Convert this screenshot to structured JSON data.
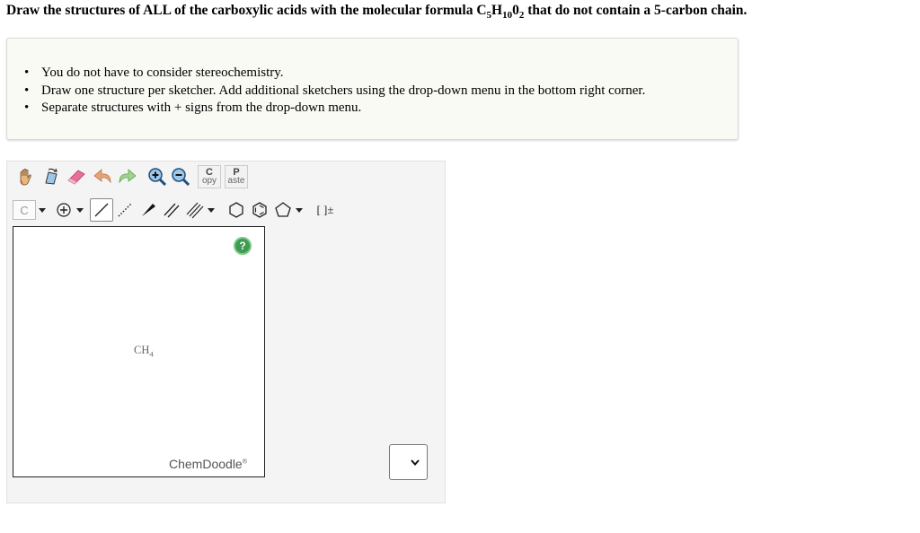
{
  "question": {
    "prefix": "Draw the structures of ALL of the carboxylic acids with the molecular formula C",
    "c_sub": "5",
    "h": "H",
    "h_sub": "10",
    "o": "0",
    "o_sub": "2",
    "suffix": " that do not contain a 5-carbon chain."
  },
  "hints": [
    "You do not have to consider stereochemistry.",
    "Draw one structure per sketcher. Add additional sketchers using the drop-down menu in the bottom right corner.",
    "Separate structures with + signs from the drop-down menu."
  ],
  "toolbar": {
    "copy_top": "C",
    "copy_bottom": "opy",
    "paste_top": "P",
    "paste_bottom": "aste",
    "element": "C",
    "charge_label": "[ ]±"
  },
  "canvas": {
    "help": "?",
    "molecule_main": "CH",
    "molecule_sub": "4",
    "brand": "ChemDoodle",
    "brand_mark": "®"
  },
  "colors": {
    "hint_bg": "#f9faf4",
    "help_green": "#3e9b52",
    "panel_bg": "#f4f4f4"
  }
}
